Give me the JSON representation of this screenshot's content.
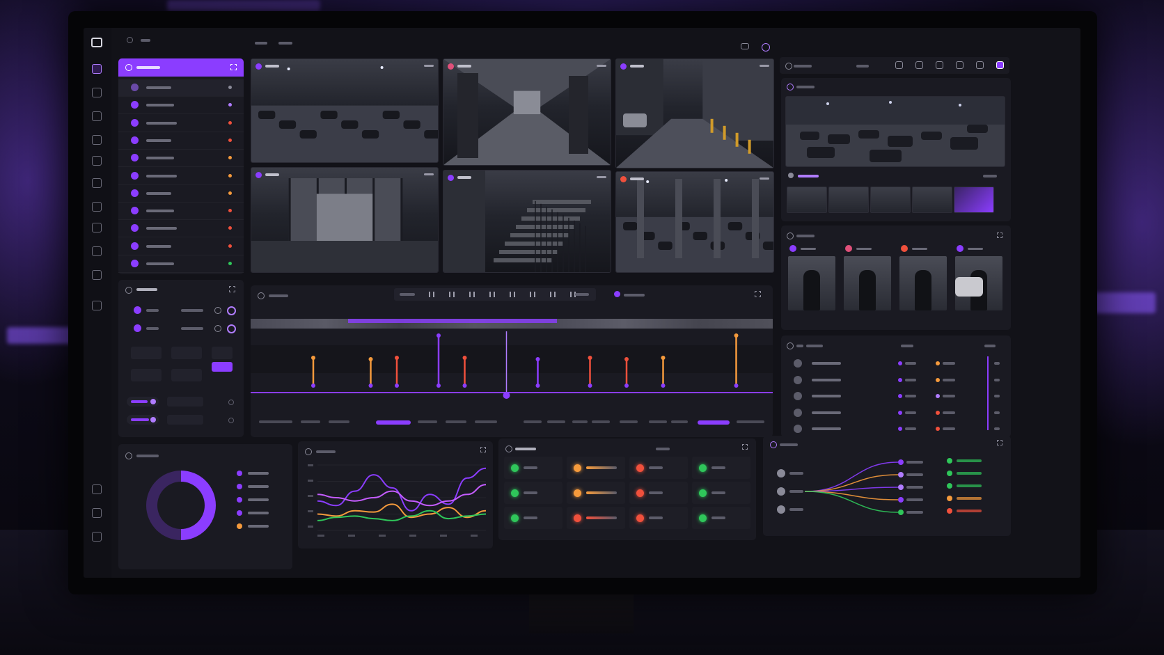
{
  "colors": {
    "accent": "#8b3dff",
    "accent_light": "#b07cff",
    "orange": "#f59a3c",
    "red": "#f0503c",
    "green": "#2fc65a",
    "bg": "#121218",
    "panel": "#1a1a22"
  },
  "topbar": {
    "icon": "camera-icon"
  },
  "sidebar": {
    "icons": [
      "home-icon",
      "grid-icon",
      "check-icon",
      "folder-icon",
      "layers-icon",
      "calendar-icon",
      "shield-icon",
      "list-icon",
      "chart-icon",
      "settings-icon",
      "bell-icon",
      "user-icon",
      "logout-icon",
      "close-icon"
    ]
  },
  "camera_list": {
    "header_icon": "camera-icon",
    "items": [
      {
        "status": "#8a8a98"
      },
      {
        "status": "#b07cff"
      },
      {
        "status": "#f0503c"
      },
      {
        "status": "#f0503c"
      },
      {
        "status": "#f59a3c"
      },
      {
        "status": "#f59a3c"
      },
      {
        "status": "#f59a3c"
      },
      {
        "status": "#f0503c"
      },
      {
        "status": "#f0503c"
      },
      {
        "status": "#f0503c"
      },
      {
        "status": "#2fc65a"
      }
    ]
  },
  "cameras": [
    {
      "scene": "parking-lot-exterior",
      "badge": "#8b3dff"
    },
    {
      "scene": "hallway",
      "badge": "#e0507a"
    },
    {
      "scene": "alley",
      "badge": "#8b3dff"
    },
    {
      "scene": "lobby-entrance",
      "badge": "#8b3dff"
    },
    {
      "scene": "stairwell",
      "badge": "#8b3dff"
    },
    {
      "scene": "parking-garage",
      "badge": "#f0503c"
    }
  ],
  "playback": {
    "controls": [
      "skip-back-icon",
      "step-back-icon",
      "pause-icon",
      "step-forward-icon",
      "rewind-icon",
      "play-icon",
      "fast-forward-icon",
      "skip-forward-icon"
    ],
    "events": [
      {
        "t": 0.12,
        "color": "#f59a3c"
      },
      {
        "t": 0.23,
        "color": "#f59a3c"
      },
      {
        "t": 0.28,
        "color": "#f0503c"
      },
      {
        "t": 0.36,
        "color": "#8b3dff"
      },
      {
        "t": 0.41,
        "color": "#f0503c"
      },
      {
        "t": 0.55,
        "color": "#8b3dff"
      },
      {
        "t": 0.65,
        "color": "#f0503c"
      },
      {
        "t": 0.72,
        "color": "#f0503c"
      },
      {
        "t": 0.79,
        "color": "#f59a3c"
      },
      {
        "t": 0.93,
        "color": "#f59a3c"
      }
    ],
    "playhead": 0.49
  },
  "detections": {
    "badges": [
      "#8b3dff",
      "#e0507a",
      "#f0503c",
      "#8b3dff"
    ],
    "scenes": [
      "person-hood",
      "person-door",
      "person-dark",
      "person-car"
    ]
  },
  "alerts_table": {
    "rows": [
      {
        "a": "#8b3dff",
        "b": "#f59a3c"
      },
      {
        "a": "#8b3dff",
        "b": "#f59a3c"
      },
      {
        "a": "#8b3dff",
        "b": "#b07cff"
      },
      {
        "a": "#8b3dff",
        "b": "#f0503c"
      },
      {
        "a": "#8b3dff",
        "b": "#f0503c"
      }
    ]
  },
  "donut": {
    "values": [
      50,
      50
    ],
    "colors": [
      "#8b3dff",
      "#3a2560"
    ],
    "legend": [
      "#8b3dff",
      "#8b3dff",
      "#8b3dff",
      "#8b3dff",
      "#f59a3c"
    ]
  },
  "line_chart": {
    "series": [
      {
        "color": "#8b3dff",
        "values": [
          0.55,
          0.62,
          0.4,
          0.15,
          0.35,
          0.7,
          0.45,
          0.6,
          0.2,
          0.05
        ]
      },
      {
        "color": "#c45cff",
        "values": [
          0.45,
          0.5,
          0.55,
          0.5,
          0.4,
          0.55,
          0.62,
          0.55,
          0.45,
          0.3
        ]
      },
      {
        "color": "#f59a3c",
        "values": [
          0.75,
          0.78,
          0.7,
          0.72,
          0.6,
          0.8,
          0.75,
          0.65,
          0.8,
          0.7
        ]
      },
      {
        "color": "#2fc65a",
        "values": [
          0.85,
          0.8,
          0.78,
          0.82,
          0.85,
          0.78,
          0.7,
          0.82,
          0.78,
          0.75
        ]
      }
    ]
  },
  "status_grid": {
    "cells": [
      [
        "#2fc65a",
        "#f59a3c",
        "#f0503c",
        "#2fc65a"
      ],
      [
        "#2fc65a",
        "#f59a3c",
        "#f0503c",
        "#2fc65a"
      ],
      [
        "#2fc65a",
        "#f0503c",
        "#f0503c",
        "#2fc65a"
      ]
    ]
  },
  "flow": {
    "sources": [
      "#8a8a98",
      "#8a8a98",
      "#8a8a98"
    ],
    "targets": [
      "#8b3dff",
      "#b07cff",
      "#b07cff",
      "#8b3dff",
      "#2fc65a"
    ],
    "legend": [
      {
        "c": "#2fc65a",
        "bar": "#2fc65a"
      },
      {
        "c": "#2fc65a",
        "bar": "#2fc65a"
      },
      {
        "c": "#2fc65a",
        "bar": "#2fc65a"
      },
      {
        "c": "#f59a3c",
        "bar": "#f59a3c"
      },
      {
        "c": "#f0503c",
        "bar": "#f0503c"
      }
    ]
  }
}
